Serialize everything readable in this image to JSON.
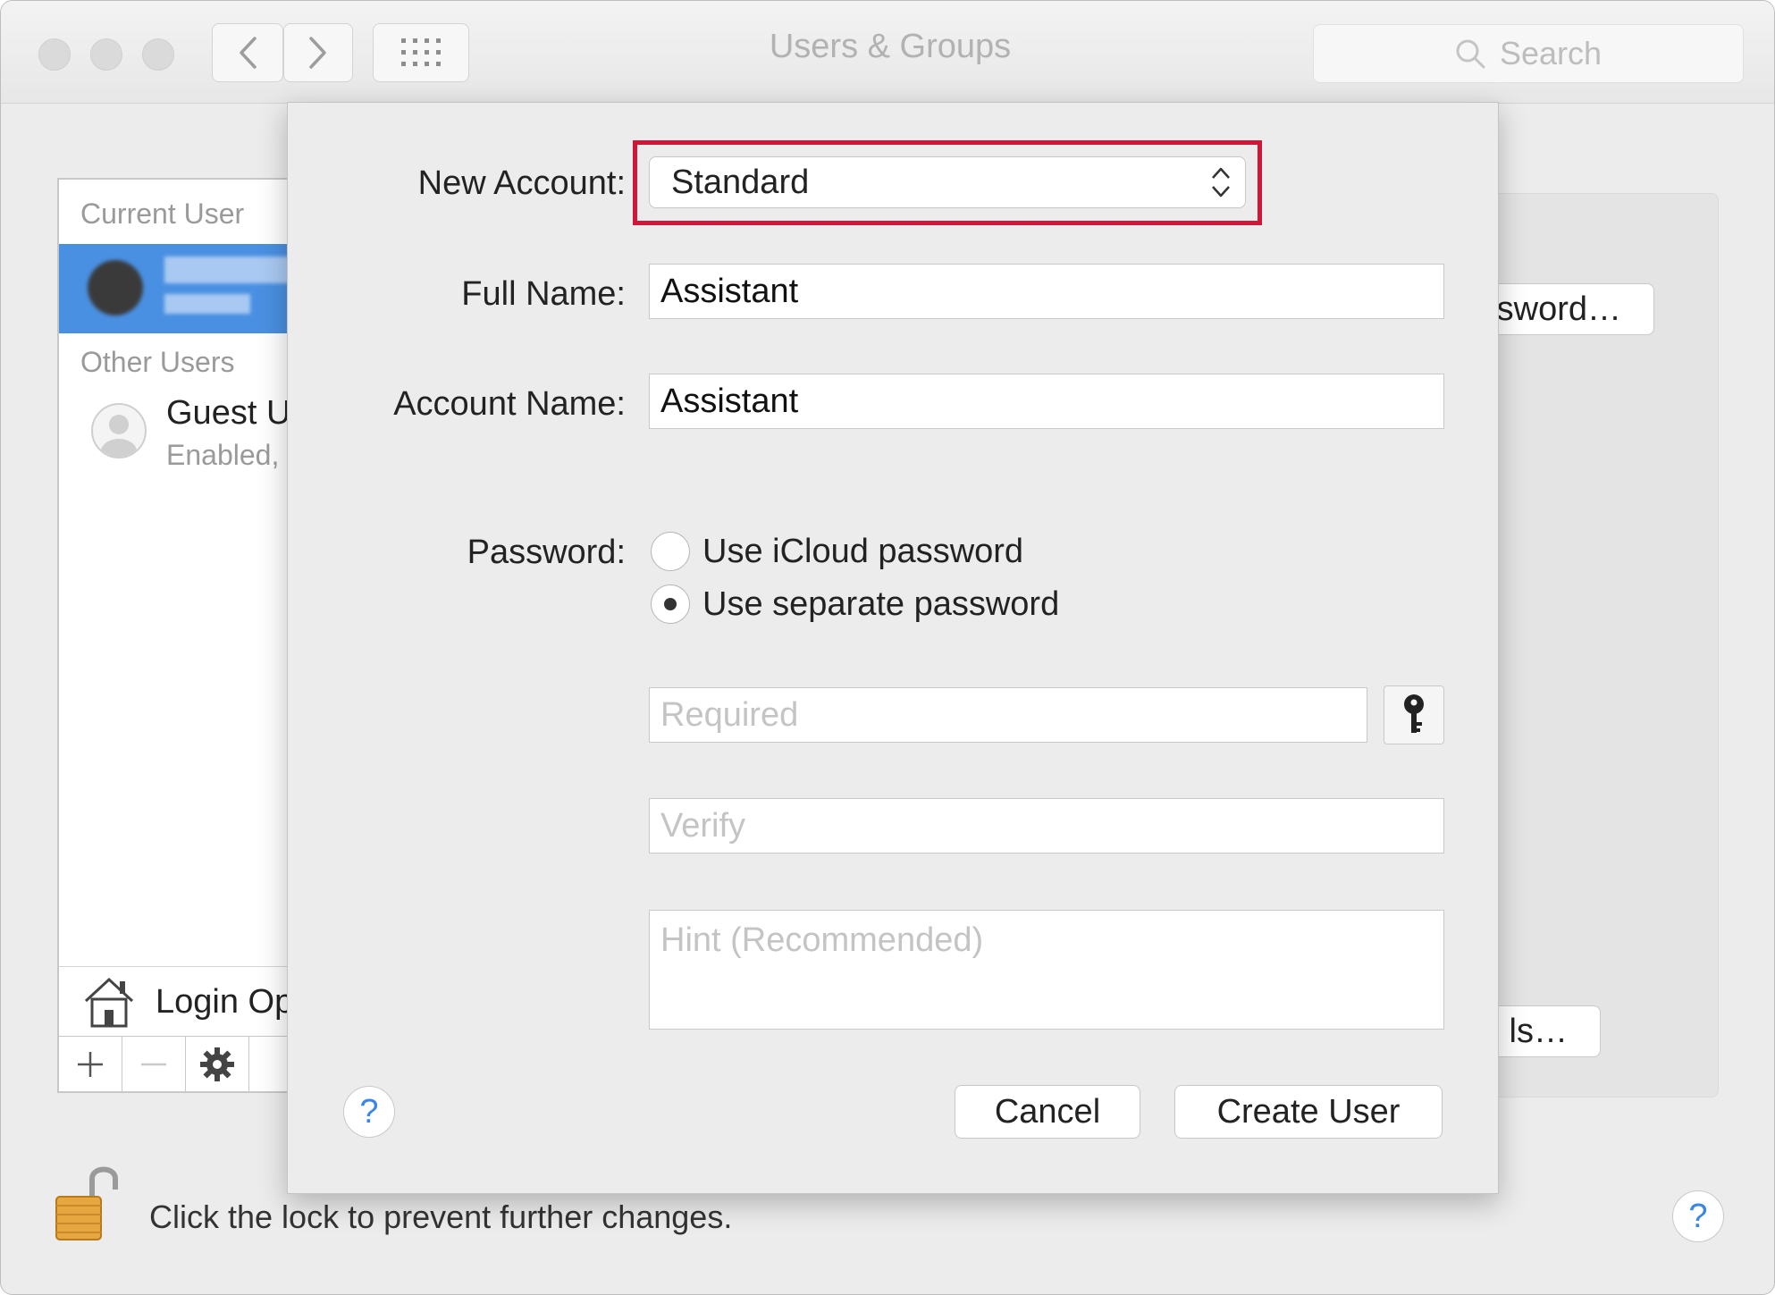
{
  "window": {
    "title": "Users & Groups",
    "search_placeholder": "Search"
  },
  "sidebar": {
    "current_user_header": "Current User",
    "other_users_header": "Other Users",
    "guest_name": "Guest U",
    "guest_status": "Enabled,",
    "login_options_label": "Login Op"
  },
  "background": {
    "password_button_label": "sword…",
    "details_button_label": "ls…",
    "lock_message": "Click the lock to prevent further changes.",
    "help_label": "?"
  },
  "sheet": {
    "new_account_label": "New Account:",
    "account_type_value": "Standard",
    "full_name_label": "Full Name:",
    "full_name_value": "Assistant",
    "account_name_label": "Account Name:",
    "account_name_value": "Assistant",
    "password_label": "Password:",
    "password_options": [
      {
        "label": "Use iCloud password",
        "selected": false
      },
      {
        "label": "Use separate password",
        "selected": true
      }
    ],
    "password_placeholder": "Required",
    "verify_placeholder": "Verify",
    "hint_placeholder": "Hint (Recommended)",
    "help_label": "?",
    "cancel_label": "Cancel",
    "create_label": "Create User"
  },
  "colors": {
    "highlight": "#d0173a",
    "selection": "#4a90e2",
    "help_accent": "#3a86e6"
  }
}
